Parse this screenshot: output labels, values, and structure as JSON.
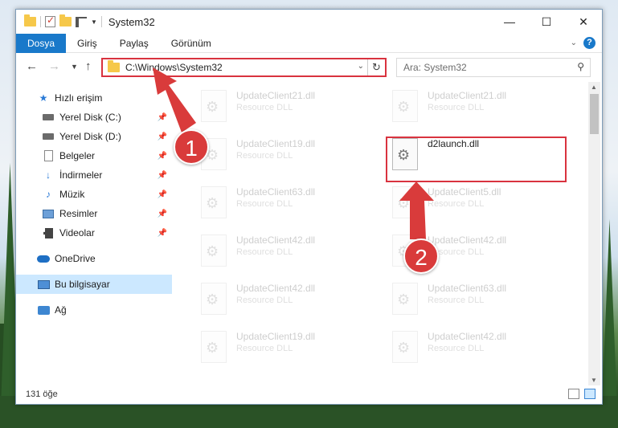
{
  "window": {
    "title": "System32",
    "controls": {
      "minimize": "—",
      "maximize": "☐",
      "close": "✕"
    }
  },
  "ribbon": {
    "tabs": [
      {
        "label": "Dosya",
        "active": true
      },
      {
        "label": "Giriş",
        "active": false
      },
      {
        "label": "Paylaş",
        "active": false
      },
      {
        "label": "Görünüm",
        "active": false
      }
    ]
  },
  "addressbar": {
    "path": "C:\\Windows\\System32",
    "search_placeholder": "Ara: System32"
  },
  "navpane": {
    "items": [
      {
        "label": "Hızlı erişim",
        "icon": "star-icon",
        "pinned": false,
        "selected": false
      },
      {
        "label": "Yerel Disk (C:)",
        "icon": "drive-icon",
        "pinned": true,
        "selected": false
      },
      {
        "label": "Yerel Disk (D:)",
        "icon": "drive-icon",
        "pinned": true,
        "selected": false
      },
      {
        "label": "Belgeler",
        "icon": "document-icon",
        "pinned": true,
        "selected": false
      },
      {
        "label": "İndirmeler",
        "icon": "download-icon",
        "pinned": true,
        "selected": false
      },
      {
        "label": "Müzik",
        "icon": "music-icon",
        "pinned": true,
        "selected": false
      },
      {
        "label": "Resimler",
        "icon": "pictures-icon",
        "pinned": true,
        "selected": false
      },
      {
        "label": "Videolar",
        "icon": "video-icon",
        "pinned": true,
        "selected": false
      },
      {
        "label": "OneDrive",
        "icon": "cloud-icon",
        "pinned": false,
        "selected": false
      },
      {
        "label": "Bu bilgisayar",
        "icon": "pc-icon",
        "pinned": false,
        "selected": true
      },
      {
        "label": "Ağ",
        "icon": "network-icon",
        "pinned": false,
        "selected": false
      }
    ]
  },
  "files": [
    {
      "name": "UpdateClient21.dll",
      "type": "Resource DLL",
      "faded": true
    },
    {
      "name": "UpdateClient21.dll",
      "type": "Resource DLL",
      "faded": true
    },
    {
      "name": "UpdateClient19.dll",
      "type": "Resource DLL",
      "faded": true
    },
    {
      "name": "d2launch.dll",
      "type": "",
      "faded": false
    },
    {
      "name": "UpdateClient63.dll",
      "type": "Resource DLL",
      "faded": true
    },
    {
      "name": "UpdateClient5.dll",
      "type": "Resource DLL",
      "faded": true
    },
    {
      "name": "UpdateClient42.dll",
      "type": "Resource DLL",
      "faded": true
    },
    {
      "name": "UpdateClient42.dll",
      "type": "Resource DLL",
      "faded": true
    },
    {
      "name": "UpdateClient42.dll",
      "type": "Resource DLL",
      "faded": true
    },
    {
      "name": "UpdateClient63.dll",
      "type": "Resource DLL",
      "faded": true
    },
    {
      "name": "UpdateClient19.dll",
      "type": "Resource DLL",
      "faded": true
    },
    {
      "name": "UpdateClient42.dll",
      "type": "Resource DLL",
      "faded": true
    }
  ],
  "status": {
    "item_count": "131 öğe"
  },
  "annotations": {
    "step1": "1",
    "step2": "2",
    "color": "#d93b3b"
  }
}
